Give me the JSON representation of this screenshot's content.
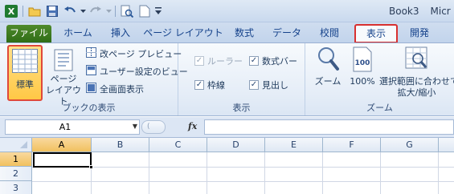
{
  "window": {
    "title": "Book3",
    "app_title_partial": "Micr"
  },
  "qat": {
    "icons": [
      "excel-logo-icon",
      "open-folder-icon",
      "save-icon",
      "undo-icon",
      "redo-icon",
      "print-preview-icon",
      "new-document-icon",
      "customize-qat-icon"
    ]
  },
  "tabs": [
    {
      "label": "ファイル",
      "key": "file"
    },
    {
      "label": "ホーム",
      "key": "home"
    },
    {
      "label": "挿入",
      "key": "insert"
    },
    {
      "label": "ページ レイアウト",
      "key": "page-layout"
    },
    {
      "label": "数式",
      "key": "formulas"
    },
    {
      "label": "データ",
      "key": "data"
    },
    {
      "label": "校閲",
      "key": "review"
    },
    {
      "label": "表示",
      "key": "view",
      "active": true
    },
    {
      "label": "開発",
      "key": "developer"
    }
  ],
  "groups": {
    "workbook_views": {
      "label": "ブックの表示",
      "normal": "標準",
      "page_layout_line1": "ページ",
      "page_layout_line2": "レイアウト",
      "page_break_preview": "改ページ プレビュー",
      "custom_views": "ユーザー設定のビュー",
      "full_screen": "全画面表示"
    },
    "show": {
      "label": "表示",
      "ruler": "ルーラー",
      "formula_bar": "数式バー",
      "gridlines": "枠線",
      "headings": "見出し"
    },
    "zoom": {
      "label": "ズーム",
      "zoom": "ズーム",
      "hundred": "100%",
      "zoom_selection_line1": "選択範囲に合わせて",
      "zoom_selection_line2": "拡大/縮小"
    }
  },
  "formula_bar": {
    "name_box": "A1",
    "fx": "fx",
    "content": ""
  },
  "grid": {
    "columns": [
      "A",
      "B",
      "C",
      "D",
      "E",
      "F",
      "G"
    ],
    "rows": [
      "1",
      "2",
      "3"
    ],
    "active_cell": "A1"
  },
  "colors": {
    "file_tab": "#2f6d17",
    "highlight": "#d83030",
    "selected_button": "#ffc845"
  }
}
